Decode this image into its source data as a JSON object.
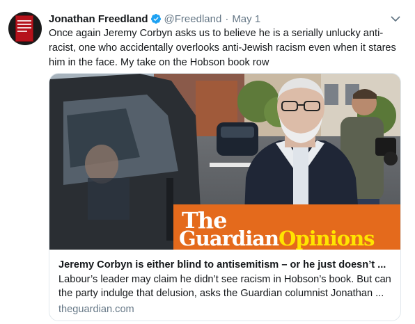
{
  "author": {
    "name": "Jonathan Freedland",
    "handle": "@Freedland",
    "separator": "·",
    "date": "May 1"
  },
  "tweet": {
    "text": "Once again Jeremy Corbyn asks us to believe he is a serially unlucky anti-racist, one who accidentally overlooks anti-Jewish racism even when it stares him in the face. My take on the Hobson book row"
  },
  "card": {
    "title": "Jeremy Corbyn is either blind to antisemitism – or he just doesn’t ...",
    "description": "Labour’s leader may claim he didn’t see racism in Hobson’s book. But can the party indulge that delusion, asks the Guardian columnist Jonathan ...",
    "domain": "theguardian.com",
    "image_logo": {
      "line1": "The",
      "line2a": "Guardian",
      "line2b": "Opinions"
    }
  },
  "colors": {
    "verified": "#1da1f2",
    "banner": "#e46a1c",
    "opinions": "#ffe500",
    "muted": "#657786",
    "border": "#e1e8ed"
  },
  "icons": {
    "verified": "verified-badge-icon",
    "menu": "chevron-down-icon"
  }
}
